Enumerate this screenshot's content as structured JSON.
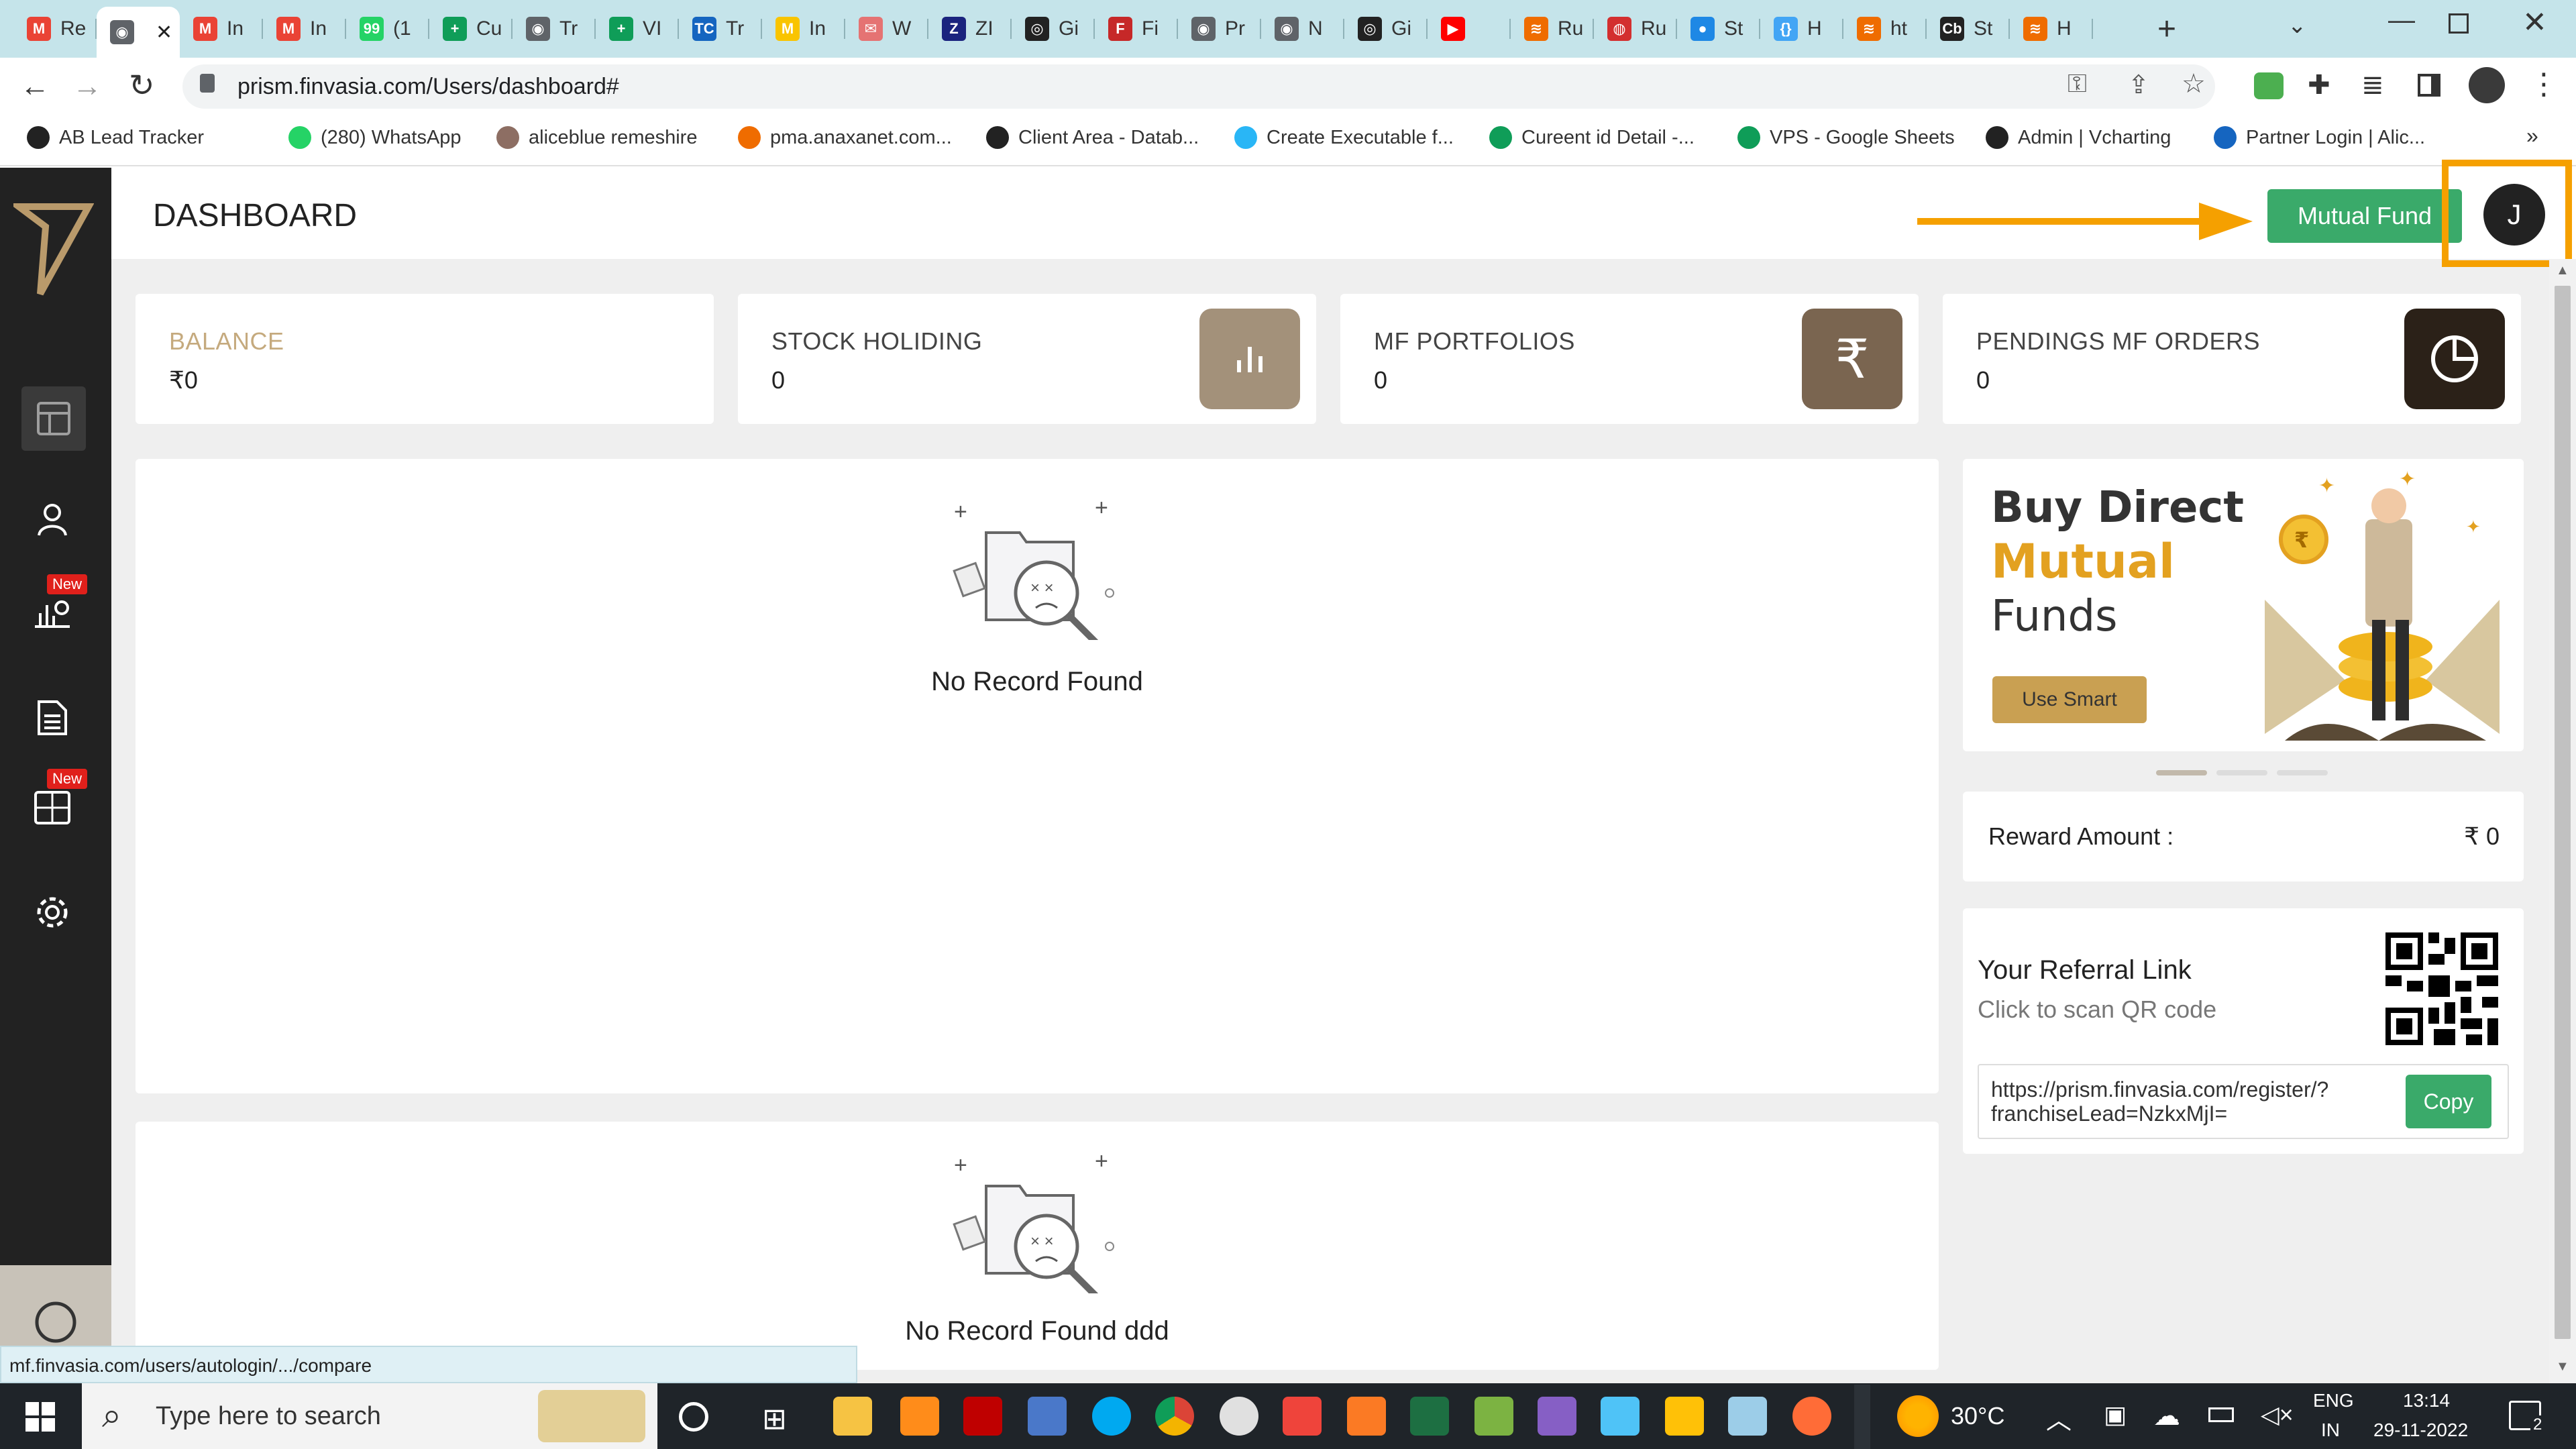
{
  "browser": {
    "tabs": [
      {
        "label": "Re",
        "color": "#ea4335",
        "glyph": "M"
      },
      {
        "label": "",
        "color": "#5f6368",
        "glyph": "◉",
        "active": true
      },
      {
        "label": "In",
        "color": "#ea4335",
        "glyph": "M"
      },
      {
        "label": "In",
        "color": "#ea4335",
        "glyph": "M"
      },
      {
        "label": "(1",
        "color": "#25d366",
        "glyph": "99"
      },
      {
        "label": "Cu",
        "color": "#0f9d58",
        "glyph": "+"
      },
      {
        "label": "Tr",
        "color": "#5f6368",
        "glyph": "◉"
      },
      {
        "label": "VI",
        "color": "#0f9d58",
        "glyph": "+"
      },
      {
        "label": "Tr",
        "color": "#1565c0",
        "glyph": "TC"
      },
      {
        "label": "In",
        "color": "#f9c400",
        "glyph": "M"
      },
      {
        "label": "W",
        "color": "#e57373",
        "glyph": "✉"
      },
      {
        "label": "ZI",
        "color": "#1a237e",
        "glyph": "Z"
      },
      {
        "label": "Gi",
        "color": "#222",
        "glyph": "◎"
      },
      {
        "label": "Fi",
        "color": "#c62828",
        "glyph": "F"
      },
      {
        "label": "Pr",
        "color": "#5f6368",
        "glyph": "◉"
      },
      {
        "label": "N",
        "color": "#5f6368",
        "glyph": "◉"
      },
      {
        "label": "Gi",
        "color": "#222",
        "glyph": "◎"
      },
      {
        "label": "",
        "color": "#ff0000",
        "glyph": "▶"
      },
      {
        "label": "Ru",
        "color": "#ef6c00",
        "glyph": "≋"
      },
      {
        "label": "Ru",
        "color": "#d32f2f",
        "glyph": "◍"
      },
      {
        "label": "St",
        "color": "#1e88e5",
        "glyph": "●"
      },
      {
        "label": "H",
        "color": "#42a5f5",
        "glyph": "{}"
      },
      {
        "label": "ht",
        "color": "#ef6c00",
        "glyph": "≋"
      },
      {
        "label": "St",
        "color": "#222",
        "glyph": "Cb"
      },
      {
        "label": "H",
        "color": "#ef6c00",
        "glyph": "≋"
      }
    ],
    "url": "prism.finvasia.com/Users/dashboard#",
    "bookmarks": [
      {
        "label": "AB Lead Tracker",
        "color": "#222"
      },
      {
        "label": "(280) WhatsApp",
        "color": "#25d366"
      },
      {
        "label": "aliceblue remeshire",
        "color": "#8d6e63"
      },
      {
        "label": "pma.anaxanet.com...",
        "color": "#ef6c00"
      },
      {
        "label": "Client Area - Datab...",
        "color": "#222"
      },
      {
        "label": "Create Executable f...",
        "color": "#29b6f6"
      },
      {
        "label": "Cureent id Detail -...",
        "color": "#0f9d58"
      },
      {
        "label": "VPS - Google Sheets",
        "color": "#0f9d58"
      },
      {
        "label": "Admin | Vcharting",
        "color": "#222"
      },
      {
        "label": "Partner Login | Alic...",
        "color": "#1565c0"
      }
    ],
    "status_url": "mf.finvasia.com/users/autologin/.../compare"
  },
  "header": {
    "title": "DASHBOARD",
    "mutual_fund_button": "Mutual Fund",
    "avatar_letter": "J"
  },
  "sidebar": {
    "new_badge": "New"
  },
  "stats": [
    {
      "label": "BALANCE",
      "value": "₹0"
    },
    {
      "label": "STOCK HOLIDING",
      "value": "0",
      "icon_color": "#a3917a"
    },
    {
      "label": "MF PORTFOLIOS",
      "value": "0",
      "icon_color": "#7a6550",
      "icon_glyph": "₹"
    },
    {
      "label": "PENDINGS MF ORDERS",
      "value": "0",
      "icon_color": "#2b2118"
    }
  ],
  "empty_panels": [
    {
      "text": "No Record Found"
    },
    {
      "text": "No Record Found ddd"
    }
  ],
  "promo": {
    "line1": "Buy Direct",
    "line2": "Mutual",
    "line3": "Funds",
    "button": "Use Smart",
    "coin_glyph": "₹"
  },
  "reward": {
    "label": "Reward Amount :",
    "value": "₹ 0"
  },
  "referral": {
    "title": "Your Referral Link",
    "subtitle": "Click to scan QR code",
    "link_line1": "https://prism.finvasia.com/register/?",
    "link_line2": "franchiseLead=NzkxMjI=",
    "copy_button": "Copy"
  },
  "taskbar": {
    "search_placeholder": "Type here to search",
    "temperature": "30°C",
    "lang_line1": "ENG",
    "lang_line2": "IN",
    "time": "13:14",
    "date": "29-11-2022",
    "notifications": "2"
  },
  "colors": {
    "accent_green": "#3aaa6a",
    "brand_gold": "#c9a052",
    "annotation_orange": "#f5a000",
    "sidebar_bg": "#222222"
  }
}
